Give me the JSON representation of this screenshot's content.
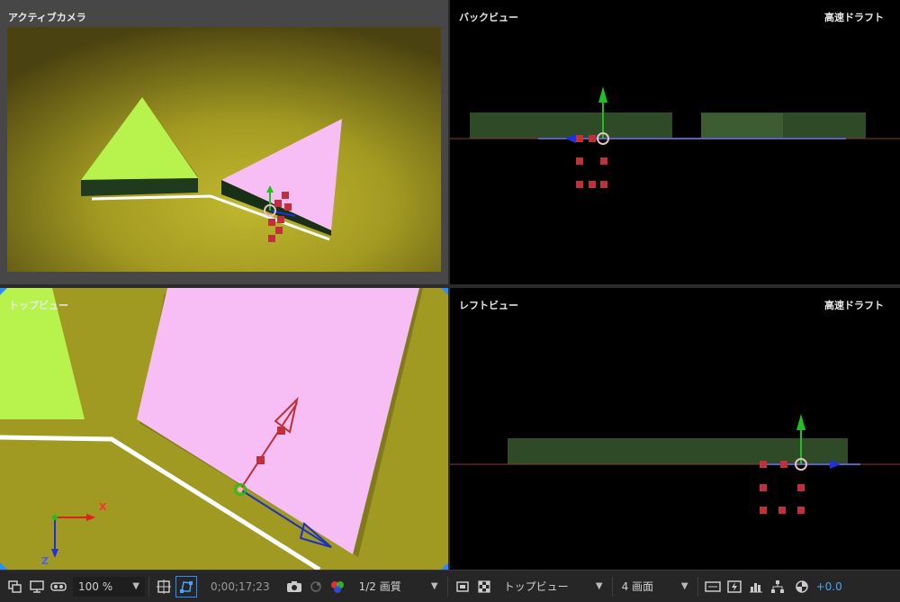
{
  "viewports": {
    "active": {
      "label": "アクティブカメラ"
    },
    "back": {
      "label": "バックビュー",
      "mode": "高速ドラフト"
    },
    "top": {
      "label": "トップビュー"
    },
    "left": {
      "label": "レフトビュー",
      "mode": "高速ドラフト"
    }
  },
  "axes": {
    "x": "X",
    "z": "Z"
  },
  "toolbar": {
    "zoom": "100 %",
    "timecode": "0;00;17;23",
    "resolution": "1/2 画質",
    "view": "トップビュー",
    "layout": "4 画面",
    "exposure": "+0.0"
  },
  "colors": {
    "accent": "#2a8cff",
    "floor": "#a09a22",
    "green_layer": "#b4f04a",
    "pink_layer": "#f7b8f5",
    "axis_x": "#e02020",
    "axis_y": "#20c020",
    "axis_z": "#2030e0"
  }
}
